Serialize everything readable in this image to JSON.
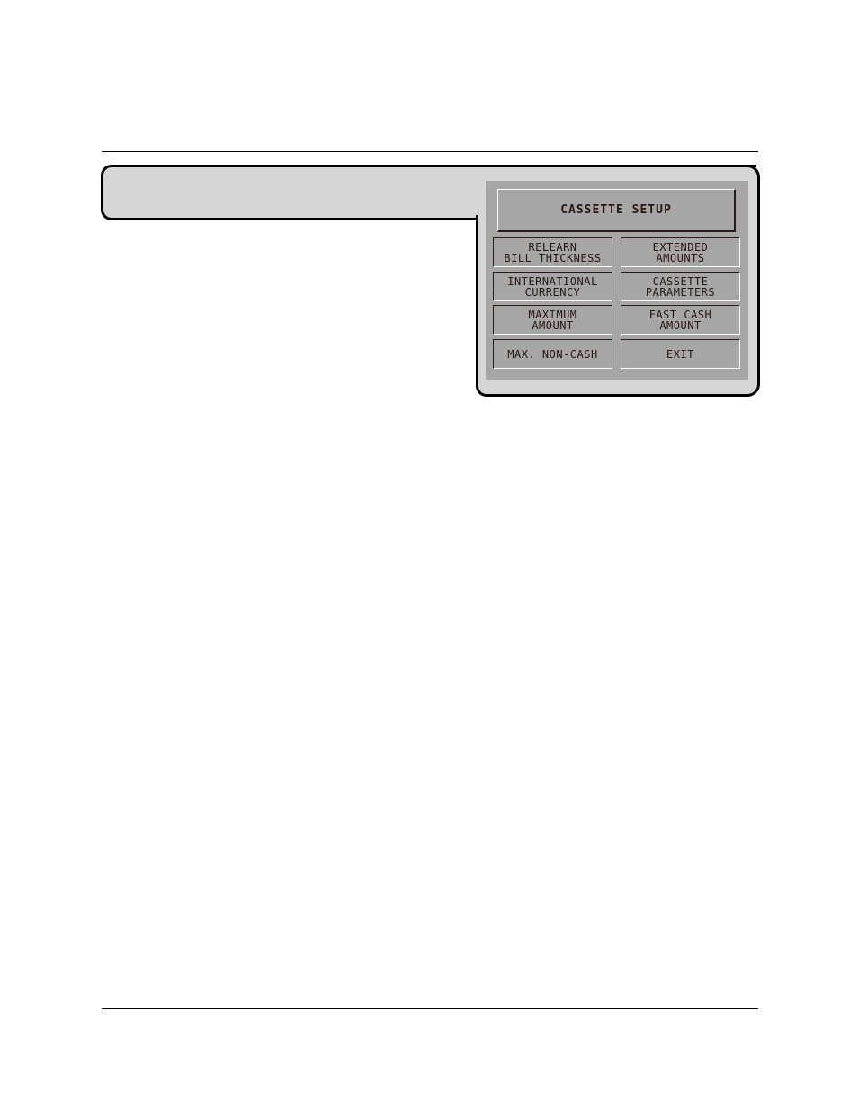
{
  "screen": {
    "title": "CASSETTE SETUP",
    "buttons": [
      {
        "id": "relearn-bill-thickness",
        "lines": [
          "RELEARN",
          "BILL THICKNESS"
        ]
      },
      {
        "id": "extended-amounts",
        "lines": [
          "EXTENDED",
          "AMOUNTS"
        ]
      },
      {
        "id": "international-currency",
        "lines": [
          "INTERNATIONAL",
          "CURRENCY"
        ]
      },
      {
        "id": "cassette-parameters",
        "lines": [
          "CASSETTE",
          "PARAMETERS"
        ]
      },
      {
        "id": "maximum-amount",
        "lines": [
          "MAXIMUM",
          "AMOUNT"
        ]
      },
      {
        "id": "fast-cash-amount",
        "lines": [
          "FAST CASH",
          "AMOUNT"
        ]
      },
      {
        "id": "max-non-cash",
        "lines": [
          "MAX. NON-CASH"
        ]
      },
      {
        "id": "exit",
        "lines": [
          "EXIT"
        ]
      }
    ]
  },
  "colors": {
    "bezel": "#d6d6d6",
    "screen": "#a6a6a6",
    "text": "#2a1515"
  }
}
